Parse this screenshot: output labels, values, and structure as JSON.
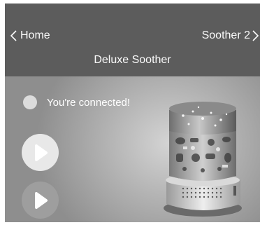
{
  "header": {
    "back_label": "Home",
    "next_label": "Soother 2",
    "title": "Deluxe Soother"
  },
  "status": {
    "text": "You're connected!"
  },
  "controls": {
    "buttons": [
      {
        "icon": "play-icon"
      },
      {
        "icon": "play-icon"
      }
    ]
  },
  "colors": {
    "header_bg": "#5c5c5c",
    "header_text": "#fafafa"
  }
}
